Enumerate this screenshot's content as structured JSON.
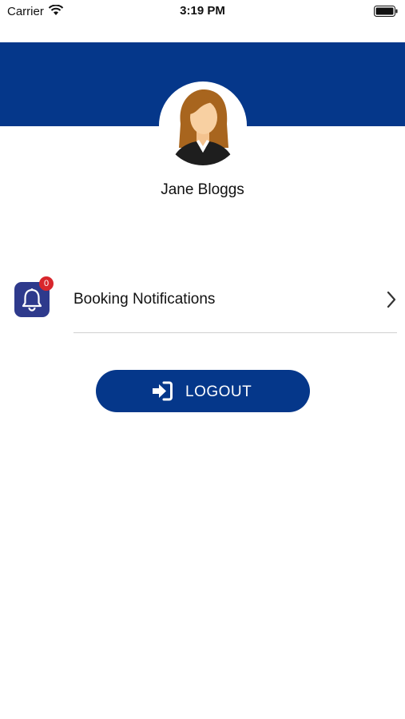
{
  "status_bar": {
    "carrier": "Carrier",
    "time": "3:19 PM",
    "icons": [
      "wifi-icon",
      "battery-icon"
    ]
  },
  "theme": {
    "primary": "#05378a",
    "badge": "#d8262c",
    "bell_tile": "#2e3a8c"
  },
  "profile": {
    "name": "Jane Bloggs",
    "avatar": "avatar-icon"
  },
  "notifications_row": {
    "label": "Booking Notifications",
    "badge_count": "0",
    "icon": "bell-icon",
    "chevron": "chevron-right-icon"
  },
  "logout": {
    "label": "LOGOUT",
    "icon": "logout-icon"
  }
}
